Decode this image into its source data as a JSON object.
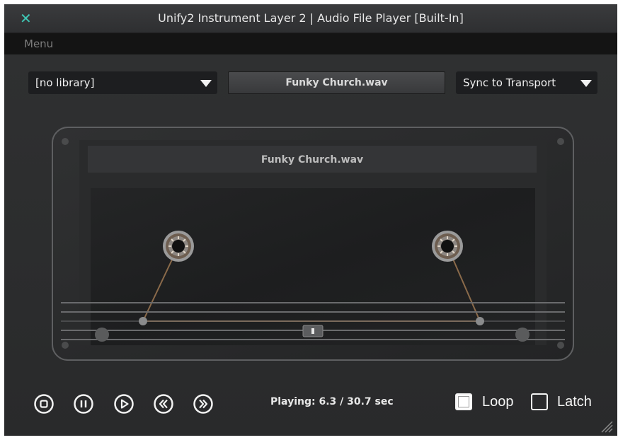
{
  "window": {
    "title": "Unify2 Instrument Layer 2 | Audio File Player [Built-In]",
    "close_icon": "close-icon"
  },
  "menubar": {
    "menu": "Menu"
  },
  "library_select": {
    "value": "[no library]"
  },
  "file_display": {
    "name": "Funky Church.wav"
  },
  "sync_select": {
    "value": "Sync to Transport"
  },
  "tape": {
    "label": "Funky Church.wav"
  },
  "transport": {
    "buttons": [
      "stop-icon",
      "pause-icon",
      "play-icon",
      "rewind-icon",
      "fast-forward-icon"
    ],
    "status": "Playing: 6.3 / 30.7 sec"
  },
  "options": {
    "loop": {
      "label": "Loop",
      "checked": true
    },
    "latch": {
      "label": "Latch",
      "checked": false
    }
  },
  "colors": {
    "close": "#3fc6b4",
    "background": "#2b2c2d",
    "tape_line": "#8a6a4a"
  }
}
